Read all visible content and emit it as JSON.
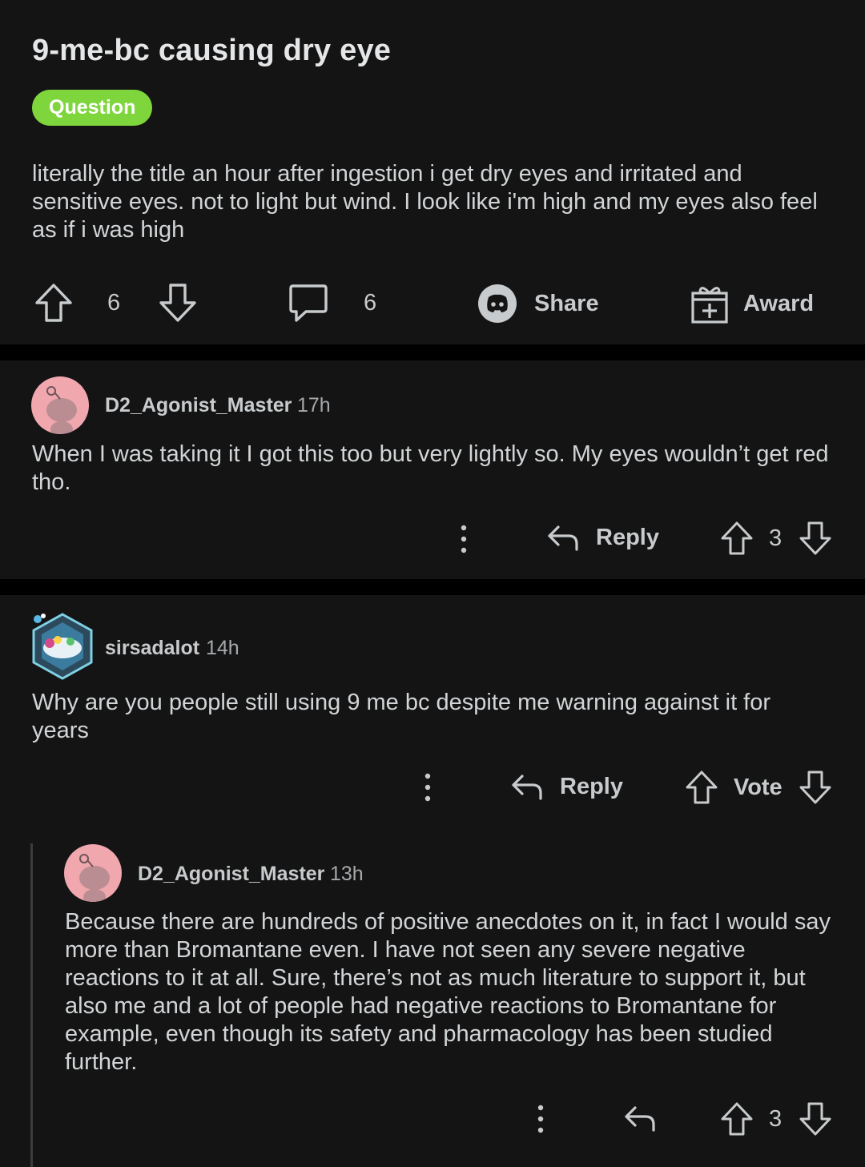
{
  "post": {
    "title": "9-me-bc causing dry eye",
    "flair": "Question",
    "body": "literally the title an hour after ingestion i get dry eyes and irritated and sensitive eyes. not to light but wind. I look like i'm high and my eyes also feel as if i was high",
    "votes": "6",
    "comments": "6",
    "share_label": "Share",
    "award_label": "Award"
  },
  "comments": [
    {
      "username": "D2_Agonist_Master",
      "time": "17h",
      "text": "When I was taking it I got this too but very lightly so. My eyes wouldn’t get red tho.",
      "reply_label": "Reply",
      "votes": "3"
    },
    {
      "username": "sirsadalot",
      "time": "14h",
      "text": "Why are you people still using 9 me bc despite me warning against it for years",
      "reply_label": "Reply",
      "votes": "Vote"
    },
    {
      "username": "D2_Agonist_Master",
      "time": "13h",
      "text": "Because there are hundreds of positive anecdotes on it, in fact I would say more than Bromantane even. I have not seen any severe negative reactions to it at all. Sure, there’s not as much literature to support it, but also me and a lot of people had negative reactions to Bromantane for example, even though its safety and pharmacology has been studied further.",
      "votes": "3"
    }
  ],
  "colors": {
    "background": "#141414",
    "separator": "#000000",
    "flair": "#7ed53c",
    "avatar_pink": "#f0a7ad"
  },
  "icons": {
    "upvote": "arrow-up-outline-icon",
    "downvote": "arrow-down-outline-icon",
    "comment": "speech-bubble-icon",
    "share": "discord-icon",
    "award": "gift-plus-icon",
    "reply": "reply-arrow-icon",
    "more": "vertical-dots-icon"
  }
}
